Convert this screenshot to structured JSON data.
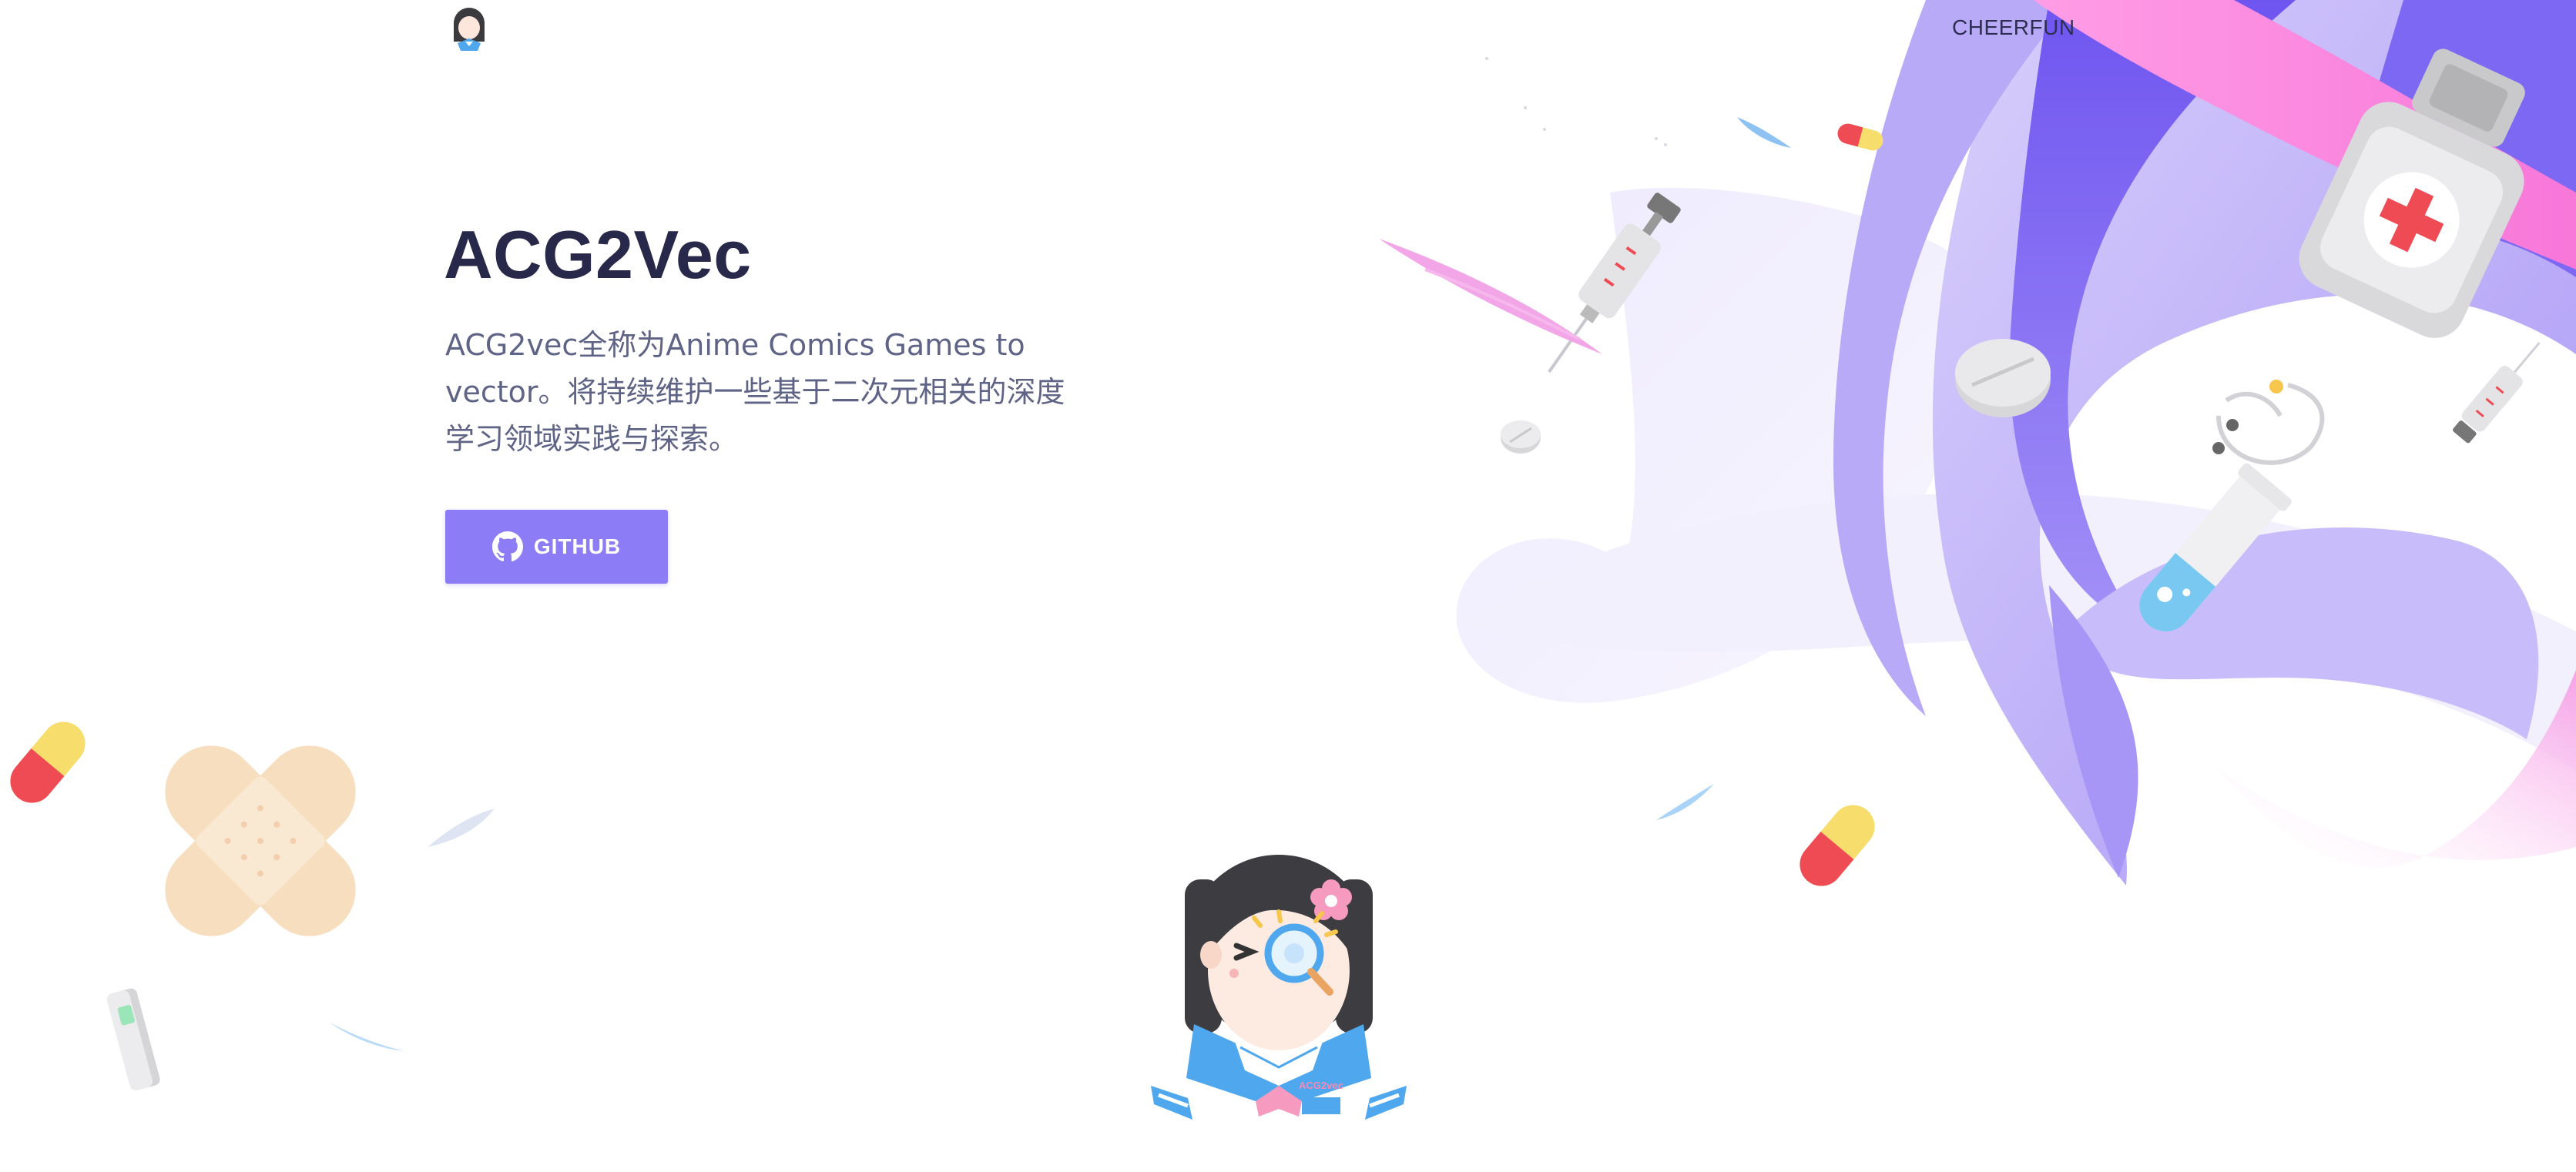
{
  "header": {
    "nav_label": "CHEERFUN"
  },
  "hero": {
    "title": "ACG2Vec",
    "description": "ACG2vec全称为Anime Comics Games to vector。将持续维护一些基于二次元相关的深度学习领域实践与探索。",
    "button_label": "GITHUB"
  },
  "mascot": {
    "badge_text": "ACG2vec"
  },
  "colors": {
    "accent": "#8c7cf6",
    "title": "#27284a",
    "body_text": "#5f6486",
    "purple_light": "#c9bff9",
    "purple_dark": "#7a64f4",
    "pink": "#f78ee0"
  },
  "icons": [
    "logo-icon",
    "github-icon",
    "syringe-icon",
    "pill-icon",
    "bandage-icon",
    "medicine-bottle-icon",
    "stethoscope-icon",
    "test-tube-icon",
    "thermometer-icon",
    "capsule-icon"
  ]
}
